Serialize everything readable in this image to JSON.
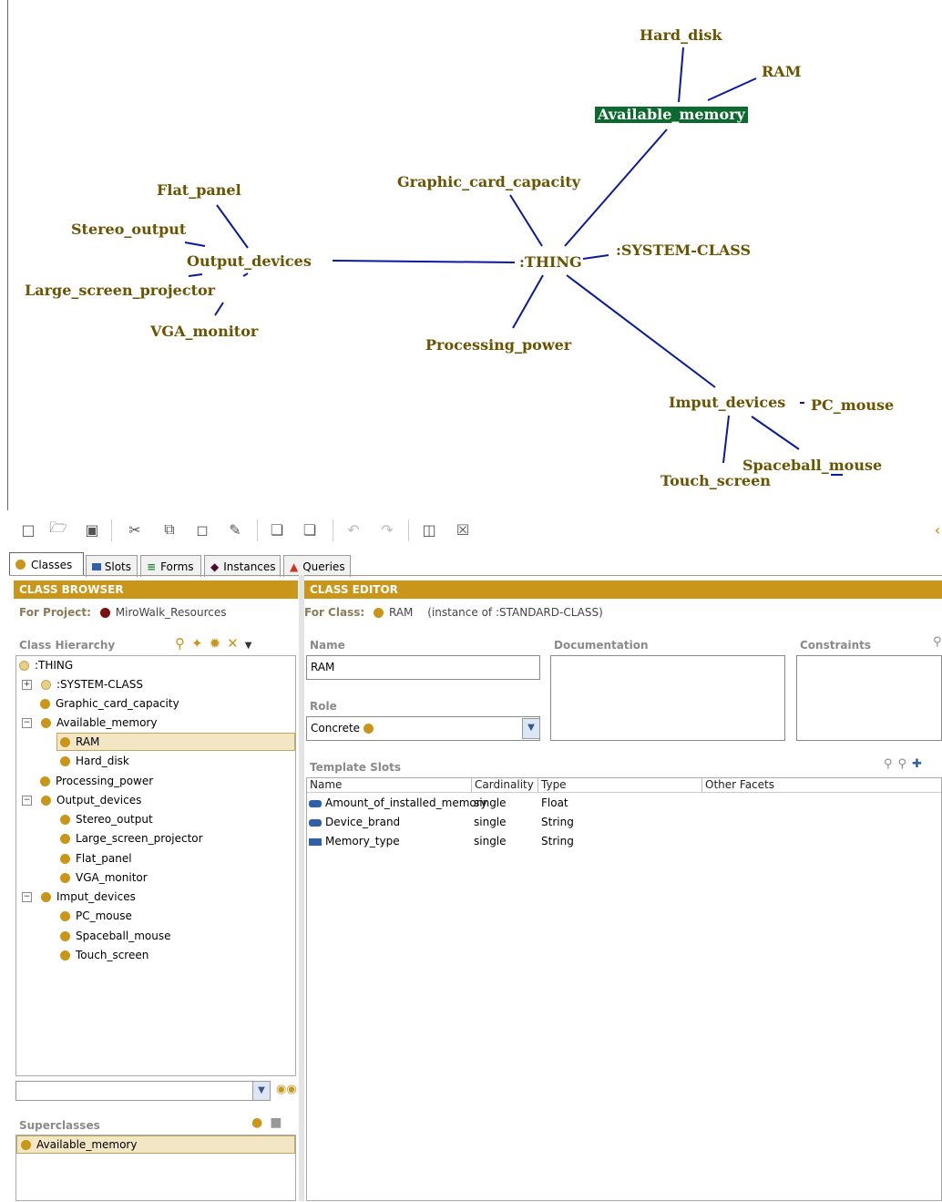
{
  "graph": {
    "nodes": {
      "hard_disk": "Hard_disk",
      "ram": "RAM",
      "available_memory": "Available_memory",
      "graphic_card_capacity": "Graphic_card_capacity",
      "system_class": ":SYSTEM-CLASS",
      "thing": ":THING",
      "flat_panel": "Flat_panel",
      "stereo_output": "Stereo_output",
      "output_devices": "Output_devices",
      "large_screen_projector": "Large_screen_projector",
      "vga_monitor": "VGA_monitor",
      "processing_power": "Processing_power",
      "input_devices": "Imput_devices",
      "pc_mouse": "PC_mouse",
      "spaceball_mouse": "Spaceball_mouse",
      "touch_screen": "Touch_screen"
    },
    "selected_node": "available_memory",
    "colors": {
      "text": "#6b5300",
      "edge": "#0a1aa0",
      "selected_bg": "#0d6a2e"
    }
  },
  "toolbar": {
    "icons": [
      "new-file-icon",
      "open-folder-icon",
      "save-icon",
      "cut-icon",
      "copy-icon",
      "paste-icon",
      "edit-icon",
      "insert-class-icon",
      "insert-subclass-icon",
      "undo-icon",
      "redo-icon",
      "window-icon",
      "close-window-icon"
    ]
  },
  "tabs": [
    {
      "label": "Classes",
      "icon": "class-dot-icon",
      "active": true
    },
    {
      "label": "Slots",
      "icon": "slot-icon"
    },
    {
      "label": "Forms",
      "icon": "forms-icon"
    },
    {
      "label": "Instances",
      "icon": "instance-diamond-icon"
    },
    {
      "label": "Queries",
      "icon": "query-icon"
    }
  ],
  "browser": {
    "header": "CLASS BROWSER",
    "for_project_label": "For Project:",
    "project_name": "MiroWalk_Resources",
    "hierarchy_label": "Class Hierarchy",
    "tree": [
      {
        "label": ":THING"
      },
      {
        "label": ":SYSTEM-CLASS"
      },
      {
        "label": "Graphic_card_capacity"
      },
      {
        "label": "Available_memory"
      },
      {
        "label": "RAM"
      },
      {
        "label": "Hard_disk"
      },
      {
        "label": "Processing_power"
      },
      {
        "label": "Output_devices"
      },
      {
        "label": "Stereo_output"
      },
      {
        "label": "Large_screen_projector"
      },
      {
        "label": "Flat_panel"
      },
      {
        "label": "VGA_monitor"
      },
      {
        "label": "Imput_devices"
      },
      {
        "label": "PC_mouse"
      },
      {
        "label": "Spaceball_mouse"
      },
      {
        "label": "Touch_screen"
      }
    ],
    "superclasses_label": "Superclasses",
    "superclasses": [
      "Available_memory"
    ]
  },
  "editor": {
    "header": "CLASS EDITOR",
    "for_class_label": "For Class:",
    "class_name": "RAM",
    "instance_of": "(instance of :STANDARD-CLASS)",
    "name_label": "Name",
    "name_value": "RAM",
    "documentation_label": "Documentation",
    "constraints_label": "Constraints",
    "role_label": "Role",
    "role_value": "Concrete",
    "template_slots_label": "Template Slots",
    "columns": [
      "Name",
      "Cardinality",
      "Type",
      "Other Facets"
    ],
    "slots": [
      {
        "name": "Amount_of_installed_memory",
        "cardinality": "single",
        "type": "Float"
      },
      {
        "name": "Device_brand",
        "cardinality": "single",
        "type": "String"
      },
      {
        "name": "Memory_type",
        "cardinality": "single",
        "type": "String"
      }
    ]
  }
}
